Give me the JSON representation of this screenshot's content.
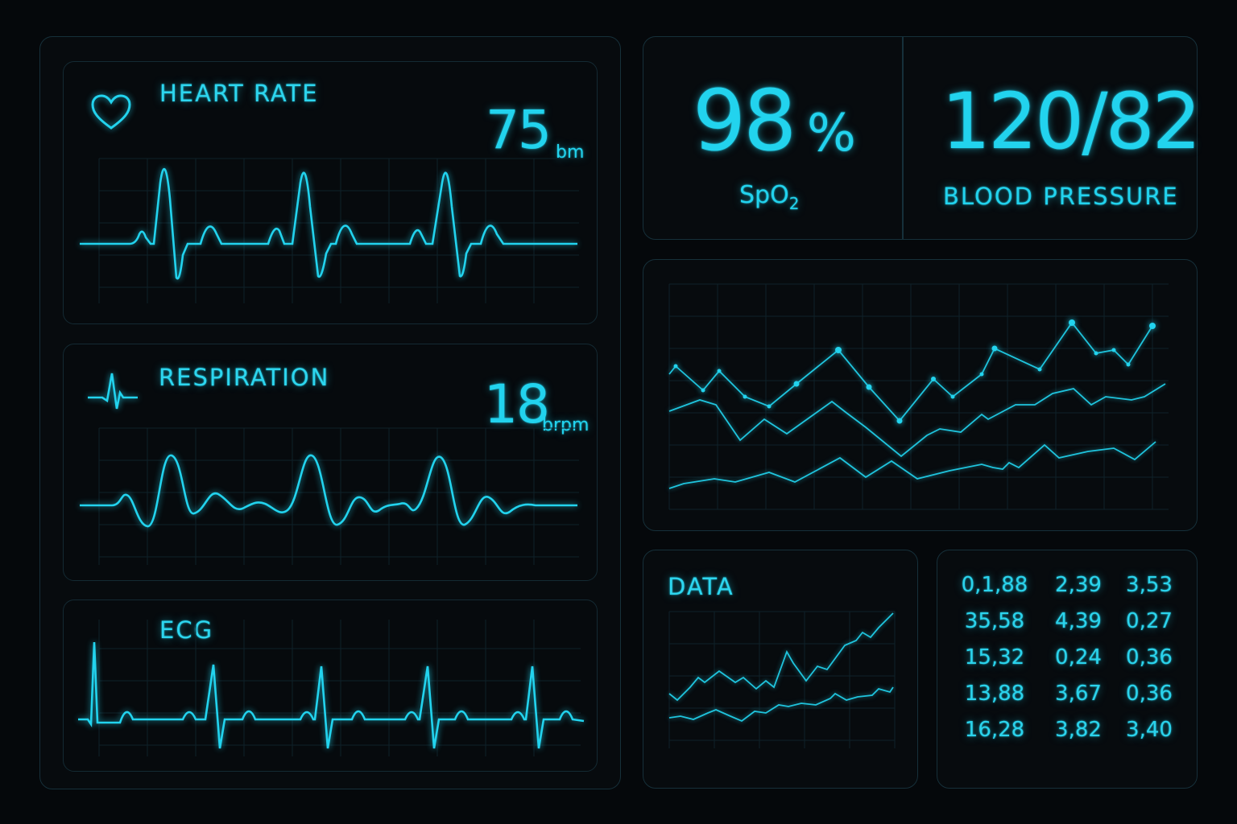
{
  "heart_rate": {
    "label": "HEART RATE",
    "value": "75",
    "unit": "bm",
    "icon": "heart-icon"
  },
  "respiration": {
    "label": "RESPIRATION",
    "value": "18",
    "unit": "brpm",
    "icon": "pulse-icon"
  },
  "ecg": {
    "label": "ECG"
  },
  "spo2": {
    "value": "98",
    "percent": "%",
    "label_main": "SpO",
    "label_sub": "2"
  },
  "blood_pressure": {
    "value": "120/82",
    "label": "BLOOD PRESSURE"
  },
  "data_panel": {
    "label": "DATA"
  },
  "table": {
    "rows": [
      [
        "0,1,88",
        "2,39",
        "3,53"
      ],
      [
        "35,58",
        "4,39",
        "0,27"
      ],
      [
        "15,32",
        "0,24",
        "0,36"
      ],
      [
        "13,88",
        "3,67",
        "0,36"
      ],
      [
        "16,28",
        "3,82",
        "3,40"
      ]
    ]
  },
  "colors": {
    "accent": "#22d3ee",
    "background": "#05080b",
    "border": "#16303a"
  }
}
